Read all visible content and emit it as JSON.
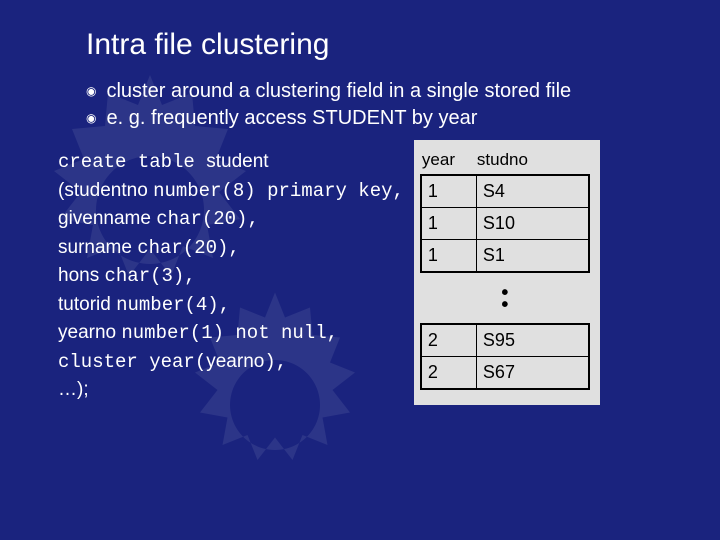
{
  "title": "Intra file clustering",
  "bullets": [
    "cluster around a clustering field in a single stored file",
    "e. g. frequently access STUDENT by year"
  ],
  "code": {
    "l1a": "create table ",
    "l1b": "student",
    "l2a": "(studentno ",
    "l2b": "number(8) primary key,",
    "l3a": "givenname ",
    "l3b": "char(20),",
    "l4a": "surname ",
    "l4b": "char(20),",
    "l5a": "hons ",
    "l5b": "char(3),",
    "l6a": "tutorid ",
    "l6b": "number(4),",
    "l7a": "yearno ",
    "l7b": "number(1) not null,",
    "l8a": "cluster year(",
    "l8b": "yearno",
    "l8c": "),",
    "l9": "…);"
  },
  "table": {
    "header": {
      "year": "year",
      "stud": "studno"
    },
    "group1": [
      {
        "year": "1",
        "stud": "S4"
      },
      {
        "year": "1",
        "stud": "S10"
      },
      {
        "year": "1",
        "stud": "S1"
      }
    ],
    "group2": [
      {
        "year": "2",
        "stud": "S95"
      },
      {
        "year": "2",
        "stud": "S67"
      }
    ]
  }
}
